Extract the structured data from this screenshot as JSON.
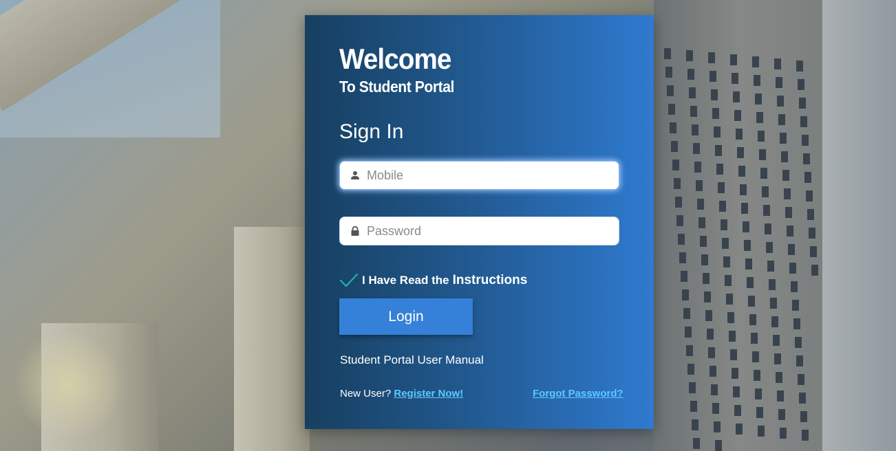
{
  "card": {
    "welcome": "Welcome",
    "subtitle": "To Student Portal",
    "signin_heading": "Sign In"
  },
  "form": {
    "mobile": {
      "value": "",
      "placeholder": "Mobile",
      "icon": "user-icon"
    },
    "password": {
      "value": "",
      "placeholder": "Password",
      "icon": "lock-icon"
    },
    "instructions": {
      "checked": true,
      "prefix": "I Have Read the",
      "link_label": "Instructions",
      "check_color": "#1fb3a6"
    },
    "login_label": "Login"
  },
  "links": {
    "manual": "Student Portal User Manual",
    "new_user_prefix": "New User?",
    "register": "Register Now!",
    "forgot": "Forgot Password?"
  },
  "colors": {
    "card_gradient_start": "#173f60",
    "card_gradient_end": "#2f7ad0",
    "login_button": "#3580d8",
    "link": "#5ec8ff"
  }
}
